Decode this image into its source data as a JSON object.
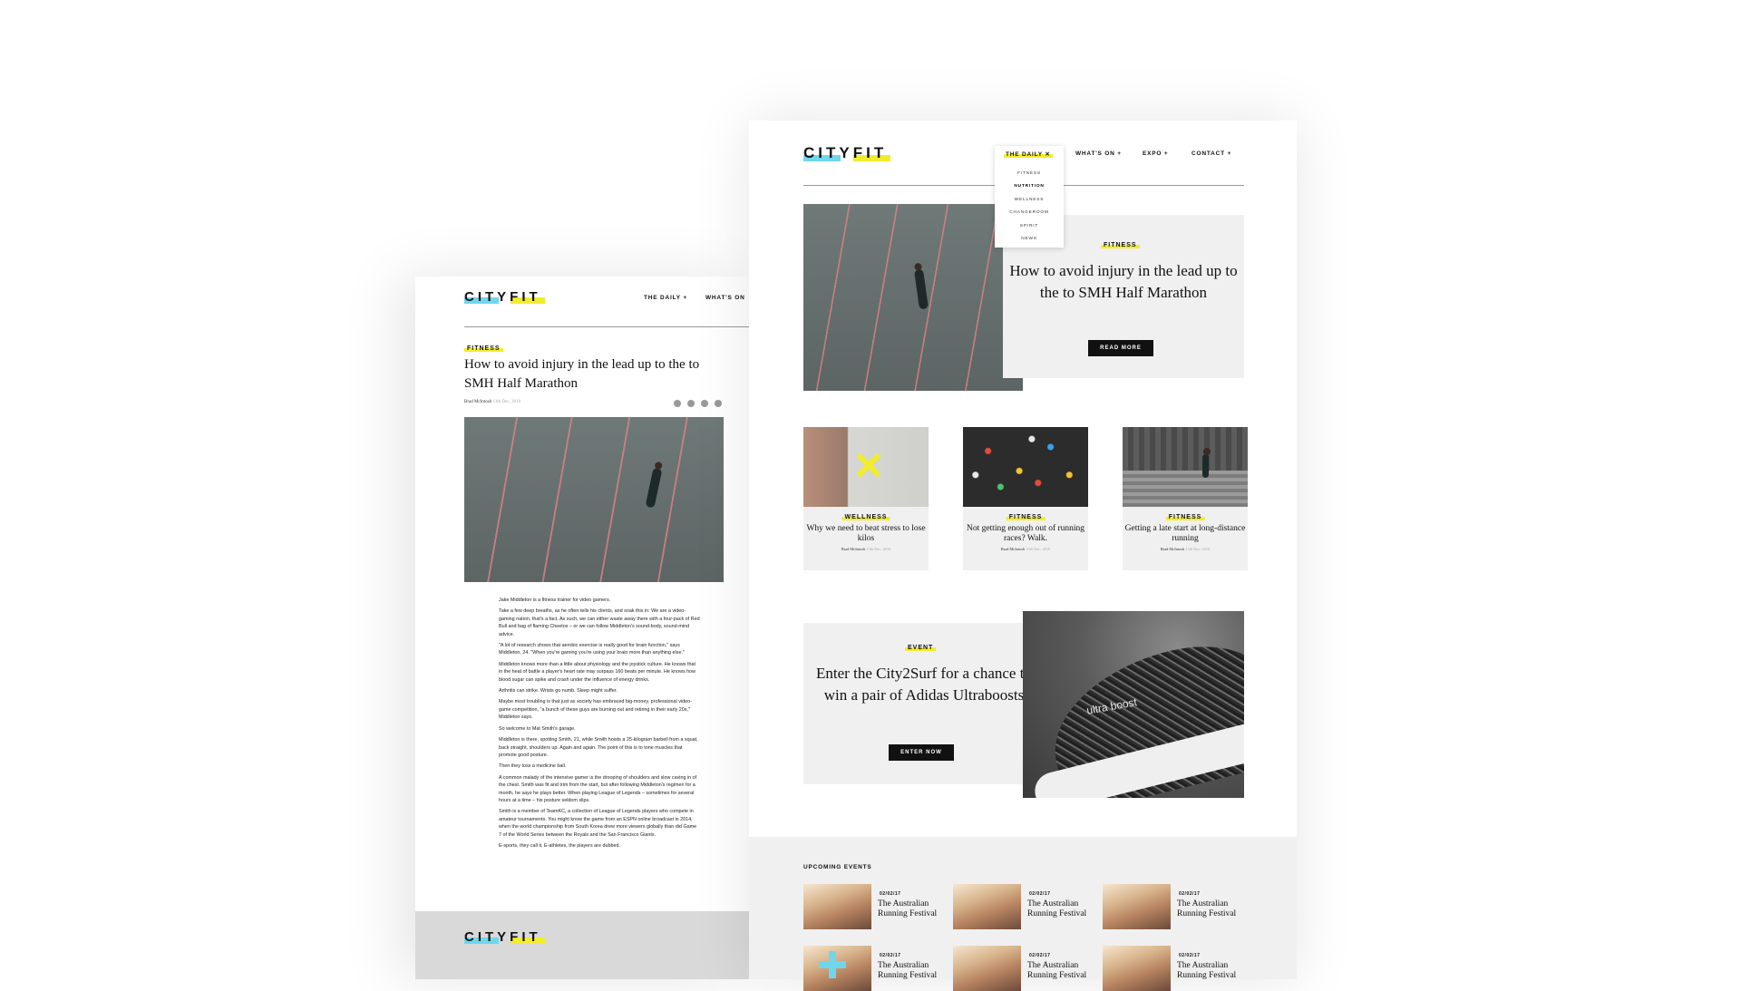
{
  "logo_text": "CITYFIT",
  "left_page": {
    "nav": [
      "THE DAILY +",
      "WHAT'S ON"
    ],
    "tag": "FITNESS",
    "title": "How to avoid injury in the lead up to the to SMH Half Marathon",
    "author": "Brad McIntosh",
    "date": "13th Dec, 2016",
    "body": [
      "Jake Middleton is a fitness trainer for video gamers.",
      "Take a few deep breaths, as he often tells his clients, and soak this in: We are a video-gaming nation, that's a fact. As such, we can either waste away there with a four-pack of Red Bull and bag of flaming Cheetos – or we can follow Middleton's sound-body, sound-mind advice.",
      "\"A lot of research shows that aerobic exercise is really good for brain function,\" says Middleton, 24. \"When you're gaming you're using your brain more than anything else.\"",
      "Middleton knows more than a little about physiology and the joystick culture. He knows that in the heat of battle a player's heart rate may surpass 160 beats per minute. He knows how blood sugar can spike and crash under the influence of energy drinks.",
      "Arthritis can strike. Wrists go numb. Sleep might suffer.",
      "Maybe most troubling is that just as society has embraced big-money, professional video-game competition, \"a bunch of these guys are burning out and retiring in their early 20s,\" Middleton says.",
      "So welcome to Mat Smith's garage.",
      "Middleton is there, spotting Smith, 21, while Smith hoists a 25-kilogram barbell from a squat, back straight, shoulders up. Again and again. The point of this is to tone muscles that promote good posture.",
      "Then they toss a medicine ball.",
      "A common malady of the intensive gamer is the drooping of shoulders and slow caving in of the chest. Smith was fit and trim from the start, but after following Middleton's regimen for a month, he says he plays better. When playing League of Legends – sometimes for several hours at a time – his posture seldom slips.",
      "Smith is a member of TeamKC, a collection of League of Legends players who compete in amateur tournaments. You might know the game from an ESPN online broadcast in 2014, when the world championship from South Korea drew more viewers globally than did Game 7 of the World Series between the Royals and the San Francisco Giants.",
      "E-sports, they call it. E-athletes, the players are dubbed."
    ]
  },
  "right_page": {
    "nav": {
      "the_daily": "THE DAILY ✕",
      "whats_on": "WHAT'S ON +",
      "expo": "EXPO +",
      "contact": "CONTACT +"
    },
    "dropdown_items": [
      "FITNESS",
      "NUTRITION",
      "WELLNESS",
      "CHANGEROOM",
      "SPIRIT",
      "NEWS"
    ],
    "dropdown_active": "NUTRITION",
    "feature": {
      "tag": "FITNESS",
      "title": "How to avoid injury in the lead up to the to SMH Half Marathon",
      "button": "READ MORE"
    },
    "cards": [
      {
        "tag": "WELLNESS",
        "title": "Why we need to beat stress to lose kilos",
        "author": "Brad McIntosh",
        "date": "13th Dec, 2016"
      },
      {
        "tag": "FITNESS",
        "title": "Not getting enough out of running races? Walk.",
        "author": "Brad McIntosh",
        "date": "13th Dec, 2016"
      },
      {
        "tag": "FITNESS",
        "title": "Getting a late start at long-distance running",
        "author": "Brad McIntosh",
        "date": "13th Dec, 2016"
      }
    ],
    "event": {
      "tag": "EVENT",
      "title": "Enter the City2Surf for a chance to win a pair of Adidas Ultraboosts",
      "button": "ENTER NOW",
      "shoe_label": "ultra boost"
    },
    "upcoming": {
      "title": "UPCOMING EVENTS",
      "items": [
        {
          "date": "02/02/17",
          "name": "The Australian Running Festival"
        },
        {
          "date": "02/02/17",
          "name": "The Australian Running Festival"
        },
        {
          "date": "02/02/17",
          "name": "The Australian Running Festival"
        },
        {
          "date": "02/02/17",
          "name": "The Australian Running Festival"
        },
        {
          "date": "02/02/17",
          "name": "The Australian Running Festival"
        },
        {
          "date": "02/02/17",
          "name": "The Australian Running Festival"
        }
      ]
    }
  },
  "colors": {
    "accent_yellow": "#f2ec2f",
    "accent_cyan": "#6fd6ec",
    "panel_grey": "#f0f0f0"
  }
}
